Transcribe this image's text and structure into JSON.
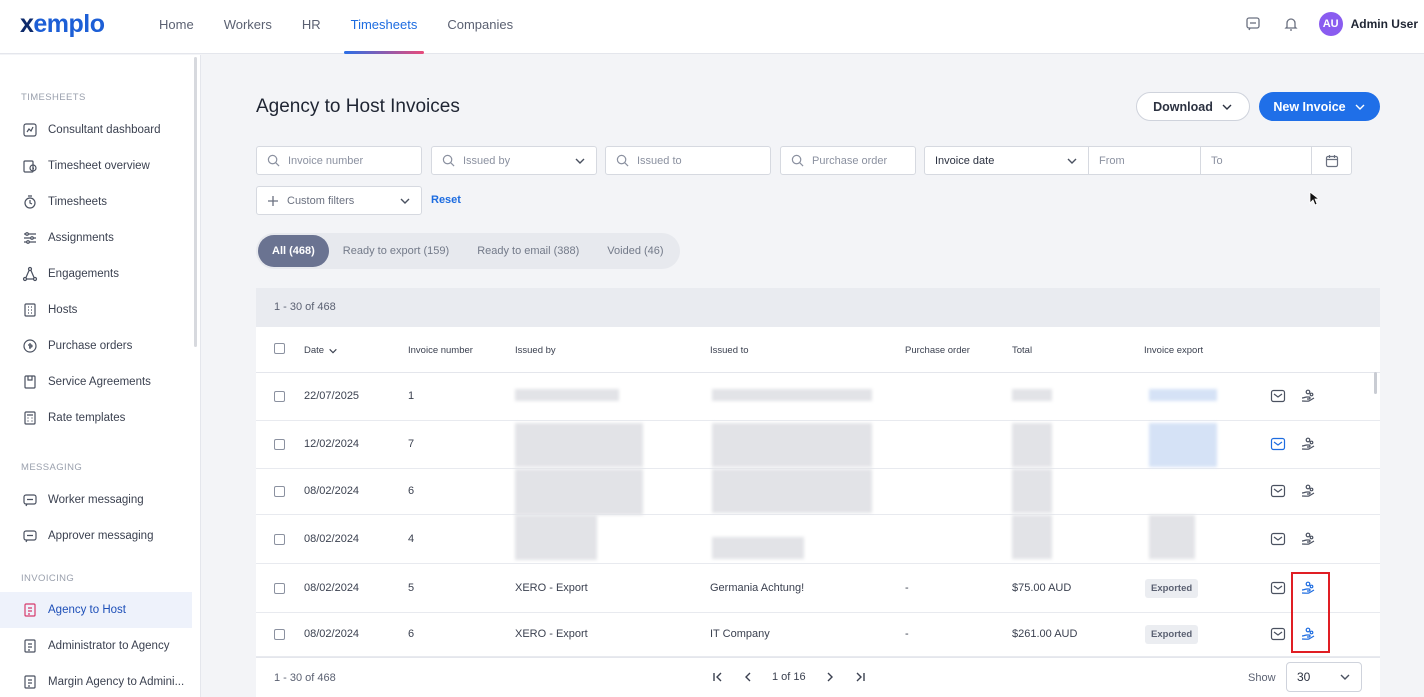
{
  "brand": {
    "logo_prefix": "x",
    "logo_rest": "emplo"
  },
  "nav": {
    "items": [
      "Home",
      "Workers",
      "HR",
      "Timesheets",
      "Companies"
    ],
    "active": "Timesheets"
  },
  "user": {
    "initials": "AU",
    "name": "Admin User"
  },
  "sidebar": {
    "sections": {
      "timesheets": "TIMESHEETS",
      "messaging": "MESSAGING",
      "invoicing": "INVOICING"
    },
    "items": [
      "Consultant dashboard",
      "Timesheet overview",
      "Timesheets",
      "Assignments",
      "Engagements",
      "Hosts",
      "Purchase orders",
      "Service Agreements",
      "Rate templates",
      "Worker messaging",
      "Approver messaging",
      "Agency to Host",
      "Administrator to Agency",
      "Margin Agency to Admini..."
    ],
    "active": "Agency to Host"
  },
  "page": {
    "title": "Agency to Host Invoices",
    "download_label": "Download",
    "new_invoice_label": "New Invoice"
  },
  "filters": {
    "invoice_number": "Invoice number",
    "issued_by": "Issued by",
    "issued_to": "Issued to",
    "purchase_order": "Purchase order",
    "date_type": "Invoice date",
    "from": "From",
    "to": "To",
    "custom": "Custom filters",
    "reset": "Reset"
  },
  "tabs": [
    {
      "label": "All (468)",
      "active": true
    },
    {
      "label": "Ready to export (159)",
      "active": false
    },
    {
      "label": "Ready to email (388)",
      "active": false
    },
    {
      "label": "Voided (46)",
      "active": false
    }
  ],
  "table": {
    "range": "1 - 30 of 468",
    "columns": [
      "Date",
      "Invoice number",
      "Issued by",
      "Issued to",
      "Purchase order",
      "Total",
      "Invoice export"
    ],
    "rows": [
      {
        "date": "22/07/2025",
        "number": "1",
        "issued_by": "",
        "issued_to": "",
        "po": "",
        "total": "",
        "export": ""
      },
      {
        "date": "12/02/2024",
        "number": "7",
        "issued_by": "",
        "issued_to": "",
        "po": "",
        "total": "",
        "export": ""
      },
      {
        "date": "08/02/2024",
        "number": "6",
        "issued_by": "",
        "issued_to": "",
        "po": "",
        "total": "",
        "export": ""
      },
      {
        "date": "08/02/2024",
        "number": "4",
        "issued_by": "",
        "issued_to": "",
        "po": "",
        "total": "",
        "export": ""
      },
      {
        "date": "08/02/2024",
        "number": "5",
        "issued_by": "XERO - Export",
        "issued_to": "Germania Achtung!",
        "po": "-",
        "total": "$75.00 AUD",
        "export": "Exported"
      },
      {
        "date": "08/02/2024",
        "number": "6",
        "issued_by": "XERO - Export",
        "issued_to": "IT Company",
        "po": "-",
        "total": "$261.00 AUD",
        "export": "Exported"
      }
    ]
  },
  "footer": {
    "range": "1 - 30 of 468",
    "page": "1 of 16",
    "show_label": "Show",
    "page_size": "30"
  },
  "colors": {
    "accent": "#1f6fe8",
    "highlight": "#e01e24",
    "active_tab": "#6a7391"
  }
}
